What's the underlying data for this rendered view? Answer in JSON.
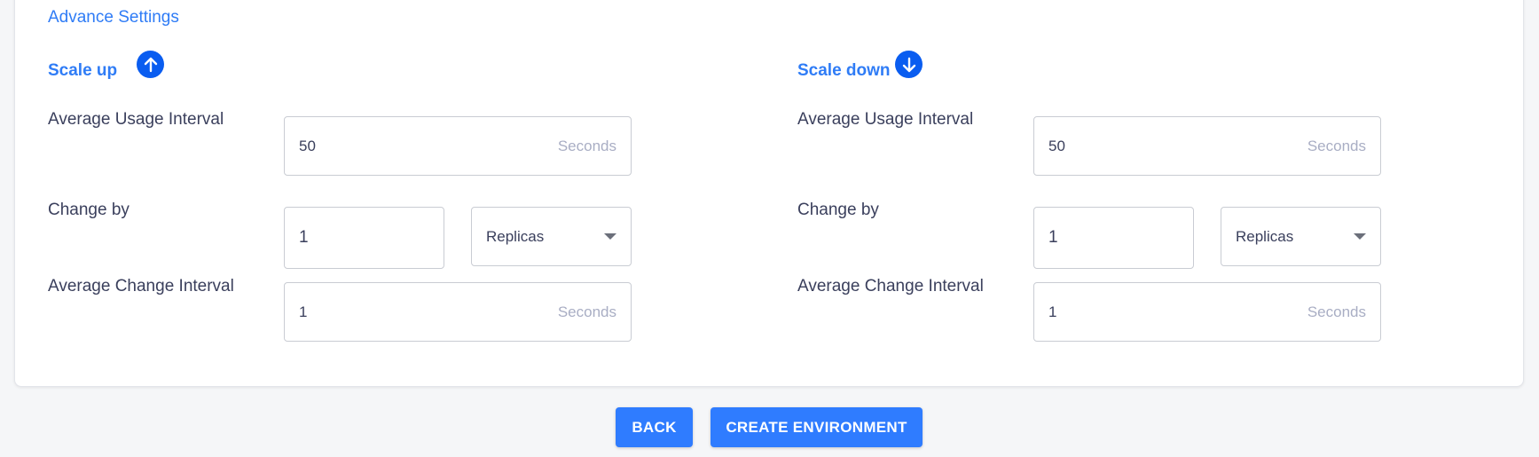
{
  "advanced": {
    "title": "Advance Settings"
  },
  "scale_up": {
    "title": "Scale up",
    "icon": "arrow-up-circle-icon",
    "avg_usage_label": "Average Usage Interval",
    "avg_usage_value": "50",
    "avg_usage_unit": "Seconds",
    "change_by_label": "Change by",
    "change_by_value": "1",
    "change_by_unit_selected": "Replicas",
    "avg_change_label": "Average Change Interval",
    "avg_change_value": "1",
    "avg_change_unit": "Seconds"
  },
  "scale_down": {
    "title": "Scale down",
    "icon": "arrow-down-circle-icon",
    "avg_usage_label": "Average Usage Interval",
    "avg_usage_value": "50",
    "avg_usage_unit": "Seconds",
    "change_by_label": "Change by",
    "change_by_value": "1",
    "change_by_unit_selected": "Replicas",
    "avg_change_label": "Average Change Interval",
    "avg_change_value": "1",
    "avg_change_unit": "Seconds"
  },
  "actions": {
    "back_label": "BACK",
    "create_label": "CREATE ENVIRONMENT"
  },
  "colors": {
    "accent": "#2f7cf6",
    "icon_bg": "#0a5df0",
    "button_bg": "#2f7cff",
    "page_bg": "#f5f6f8"
  }
}
